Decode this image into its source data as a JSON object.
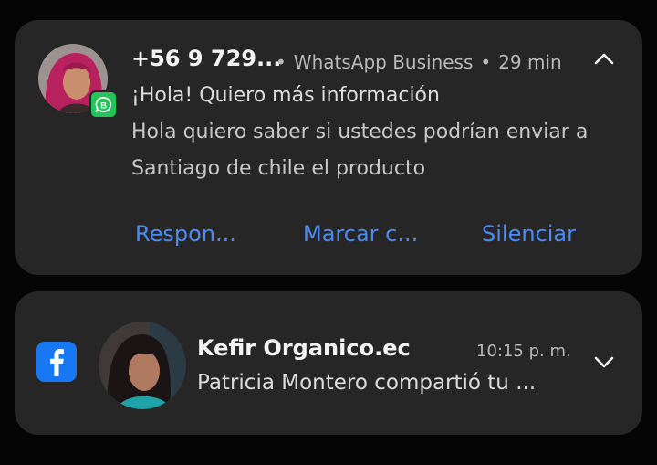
{
  "notification1": {
    "sender": "+56 9 729...",
    "app": "WhatsApp Business",
    "time": "29 min",
    "title": "¡Hola! Quiero más información",
    "body_line1": "Hola quiero saber si ustedes podrían enviar a",
    "body_line2": "Santiago de chile el producto",
    "actions": [
      "Respon...",
      "Marcar c...",
      "Silenciar"
    ],
    "app_icon": "whatsapp-business-icon",
    "expand_icon": "chevron-up-icon"
  },
  "notification2": {
    "sender": "Kefir Organico.ec",
    "time": "10:15 p. m.",
    "body": "Patricia Montero compartió tu ...",
    "app_icon": "facebook-icon",
    "expand_icon": "chevron-down-icon"
  },
  "colors": {
    "background": "#050505",
    "card": "#262626",
    "action_link": "#4e8bf0",
    "whatsapp_green": "#25c35a",
    "facebook_blue": "#1877f2"
  }
}
